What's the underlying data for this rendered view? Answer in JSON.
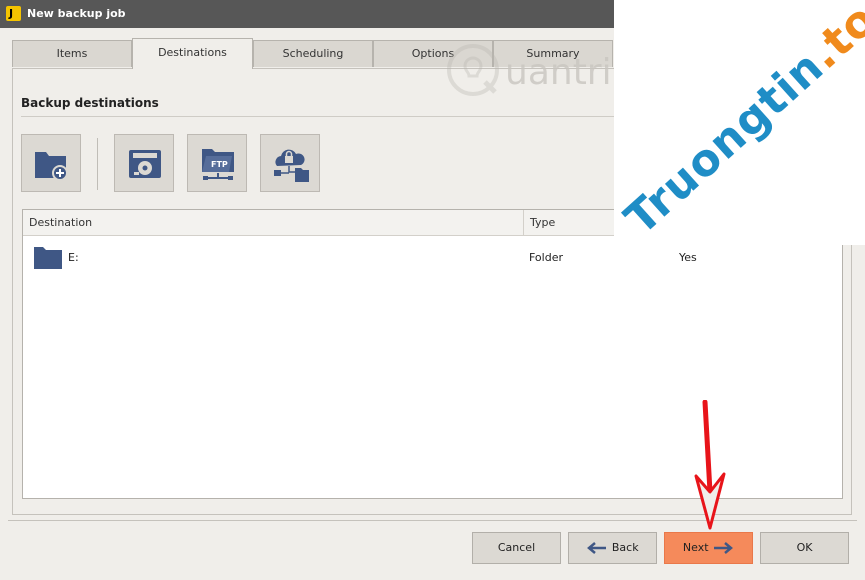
{
  "window": {
    "title": "New backup job",
    "app_icon_letter": "J"
  },
  "tabs": [
    {
      "label": "Items",
      "active": false
    },
    {
      "label": "Destinations",
      "active": true
    },
    {
      "label": "Scheduling",
      "active": false
    },
    {
      "label": "Options",
      "active": false
    },
    {
      "label": "Summary",
      "active": false
    }
  ],
  "section": {
    "title": "Backup destinations"
  },
  "toolbar": {
    "buttons": [
      {
        "icon": "add-folder-icon"
      },
      {
        "icon": "local-drive-icon"
      },
      {
        "icon": "ftp-folder-icon"
      },
      {
        "icon": "cloud-lock-folder-icon"
      }
    ],
    "ftp_label": "FTP"
  },
  "list": {
    "columns": [
      "Destination",
      "Type",
      ""
    ],
    "rows": [
      {
        "destination": "E:",
        "type": "Folder",
        "third": "Yes"
      }
    ]
  },
  "footer": {
    "cancel_label": "Cancel",
    "back_label": "Back",
    "next_label": "Next",
    "ok_label": "OK"
  },
  "watermark": {
    "brand": "Truongtin",
    "dot": ".",
    "tld": "top",
    "quantri": "uantri"
  },
  "colors": {
    "titlebar": "#575757",
    "accent_button": "#f58a5b",
    "icon_blue": "#3f5785",
    "watermark_blue": "#1f8dc6",
    "watermark_orange": "#f08a1c",
    "annotation_red": "#e8141a"
  }
}
